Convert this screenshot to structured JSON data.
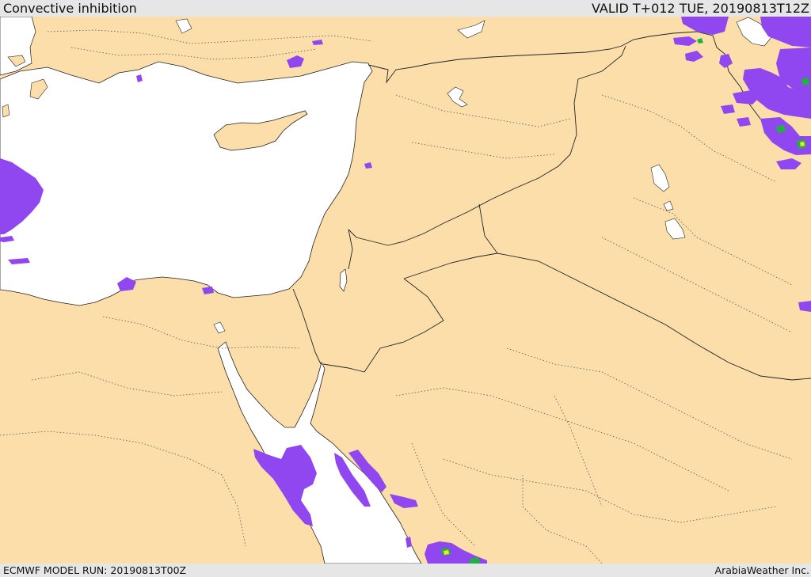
{
  "header": {
    "title": "Convective inhibition",
    "valid": "VALID T+012 TUE, 20190813T12Z"
  },
  "footer": {
    "model_run": "ECMWF MODEL RUN: 20190813T00Z",
    "brand": "ArabiaWeather Inc."
  },
  "map": {
    "colors": {
      "land": "#fcdeaa",
      "water": "#ffffff",
      "coast": "#222222",
      "cin_light": "#9147f0",
      "cin_green": "#1eb43c",
      "cin_yellow": "#f5e628"
    }
  }
}
